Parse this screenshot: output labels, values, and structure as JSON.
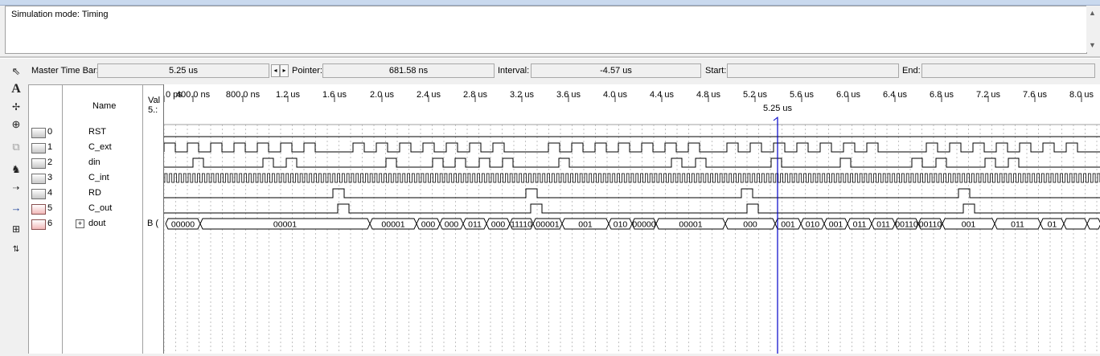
{
  "message": {
    "text": "Simulation mode: Timing"
  },
  "toolbar": {
    "master_label": "Master Time Bar:",
    "master_value": "5.25 us",
    "pointer_label": "Pointer:",
    "pointer_value": "681.58 ns",
    "interval_label": "Interval:",
    "interval_value": "-4.57 us",
    "start_label": "Start:",
    "start_value": "",
    "end_label": "End:",
    "end_value": ""
  },
  "table": {
    "name_header": "Name",
    "value_header": "Val",
    "value_subheader": "5.:"
  },
  "time_axis": {
    "ticks": [
      "0 ps",
      "400.0 ns",
      "800.0 ns",
      "1.2 us",
      "1.6 us",
      "2.0 us",
      "2.4 us",
      "2.8 us",
      "3.2 us",
      "3.6 us",
      "4.0 us",
      "4.4 us",
      "4.8 us",
      "5.2 us",
      "5.6 us",
      "6.0 us",
      "6.4 us",
      "6.8 us",
      "7.2 us",
      "7.6 us",
      "8.0 us"
    ],
    "marker_label": "5.25 us"
  },
  "signals": [
    {
      "index": "0",
      "name": "RST",
      "value": "",
      "kind": "in"
    },
    {
      "index": "1",
      "name": "C_ext",
      "value": "",
      "kind": "in"
    },
    {
      "index": "2",
      "name": "din",
      "value": "",
      "kind": "in"
    },
    {
      "index": "3",
      "name": "C_int",
      "value": "",
      "kind": "in"
    },
    {
      "index": "4",
      "name": "RD",
      "value": "",
      "kind": "in"
    },
    {
      "index": "5",
      "name": "C_out",
      "value": "",
      "kind": "out"
    },
    {
      "index": "6",
      "name": "dout",
      "value": "B (",
      "kind": "out"
    }
  ],
  "bus_labels": [
    "00000",
    "00001",
    "00001",
    "000",
    "000",
    "011",
    "000",
    "11110",
    "00001",
    "001",
    "010",
    "00000",
    "00001",
    "000",
    "001",
    "010",
    "001",
    "011",
    "011",
    "00110",
    "00110",
    "001",
    "011",
    "01"
  ],
  "colors": {
    "cursor": "#0000c8",
    "grid": "#9a9a9a"
  }
}
